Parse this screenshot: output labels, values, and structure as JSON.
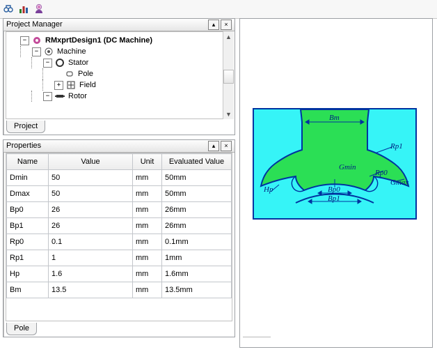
{
  "toolbar_icons": [
    "binoculars-icon",
    "chart-columns-icon",
    "person-gear-icon"
  ],
  "panels": {
    "pm": {
      "title": "Project Manager",
      "tab": "Project"
    },
    "pp": {
      "title": "Properties",
      "tab": "Pole"
    }
  },
  "tree": {
    "root": {
      "label": "RMxprtDesign1 (DC Machine)"
    },
    "machine": {
      "label": "Machine"
    },
    "stator": {
      "label": "Stator"
    },
    "pole": {
      "label": "Pole"
    },
    "field": {
      "label": "Field"
    },
    "rotor": {
      "label": "Rotor"
    }
  },
  "props": {
    "headers": {
      "name": "Name",
      "value": "Value",
      "unit": "Unit",
      "eval": "Evaluated Value"
    },
    "rows": [
      {
        "name": "Dmin",
        "value": "50",
        "unit": "mm",
        "eval": "50mm"
      },
      {
        "name": "Dmax",
        "value": "50",
        "unit": "mm",
        "eval": "50mm"
      },
      {
        "name": "Bp0",
        "value": "26",
        "unit": "mm",
        "eval": "26mm"
      },
      {
        "name": "Bp1",
        "value": "26",
        "unit": "mm",
        "eval": "26mm"
      },
      {
        "name": "Rp0",
        "value": "0.1",
        "unit": "mm",
        "eval": "0.1mm"
      },
      {
        "name": "Rp1",
        "value": "1",
        "unit": "mm",
        "eval": "1mm"
      },
      {
        "name": "Hp",
        "value": "1.6",
        "unit": "mm",
        "eval": "1.6mm"
      },
      {
        "name": "Bm",
        "value": "13.5",
        "unit": "mm",
        "eval": "13.5mm"
      }
    ]
  },
  "diagram_labels": {
    "Bm": "Bm",
    "Rp1": "Rp1",
    "Gmin": "Gmin",
    "Rp0": "Rp0",
    "Gmax": "Gmax",
    "Hp": "Hp",
    "Bp0": "Bp0",
    "Bp1": "Bp1"
  }
}
